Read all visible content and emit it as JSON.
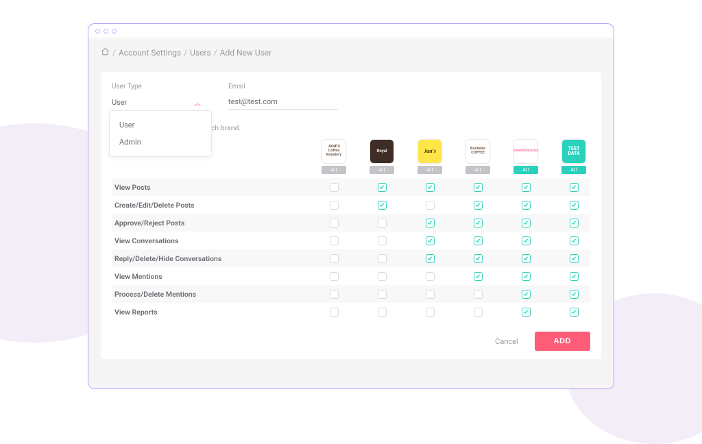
{
  "breadcrumb": {
    "home_label": "Home",
    "account_settings": "Account Settings",
    "users": "Users",
    "add_new_user": "Add New User"
  },
  "form": {
    "user_type_label": "User Type",
    "user_type_value": "User",
    "email_label": "Email",
    "email_value": "test@test.com",
    "helper_text": "Manage the permissions for each brand."
  },
  "dropdown": {
    "option_user": "User",
    "option_admin": "Admin"
  },
  "brands": [
    {
      "name": "JANE'S Coffee Roastery",
      "tile_class": "",
      "all_active": false
    },
    {
      "name": "Royal",
      "tile_class": "royal",
      "all_active": false
    },
    {
      "name": "Jan's",
      "tile_class": "yellow",
      "all_active": false
    },
    {
      "name": "Buckster COFFEE",
      "tile_class": "",
      "all_active": false
    },
    {
      "name": "SweetDelicacies",
      "tile_class": "donut",
      "all_active": true
    },
    {
      "name": "TEST DATA",
      "tile_class": "test",
      "all_active": true
    }
  ],
  "all_label": "All",
  "permissions": [
    {
      "label": "View Posts",
      "cells": [
        false,
        true,
        true,
        true,
        true,
        true
      ]
    },
    {
      "label": "Create/Edit/Delete Posts",
      "cells": [
        false,
        true,
        false,
        true,
        true,
        true
      ]
    },
    {
      "label": "Approve/Reject Posts",
      "cells": [
        false,
        false,
        true,
        true,
        true,
        true
      ]
    },
    {
      "label": "View Conversations",
      "cells": [
        false,
        false,
        true,
        true,
        true,
        true
      ]
    },
    {
      "label": "Reply/Delete/Hide Conversations",
      "cells": [
        false,
        false,
        true,
        true,
        true,
        true
      ]
    },
    {
      "label": "View Mentions",
      "cells": [
        false,
        false,
        false,
        true,
        true,
        true
      ]
    },
    {
      "label": "Process/Delete Mentions",
      "cells": [
        false,
        false,
        false,
        false,
        true,
        true
      ]
    },
    {
      "label": "View Reports",
      "cells": [
        false,
        false,
        false,
        false,
        true,
        true
      ]
    }
  ],
  "actions": {
    "cancel": "Cancel",
    "add": "ADD"
  },
  "colors": {
    "accent_teal": "#2ad1bd",
    "accent_pink": "#ff5c78",
    "frame_purple": "#b79cff"
  }
}
